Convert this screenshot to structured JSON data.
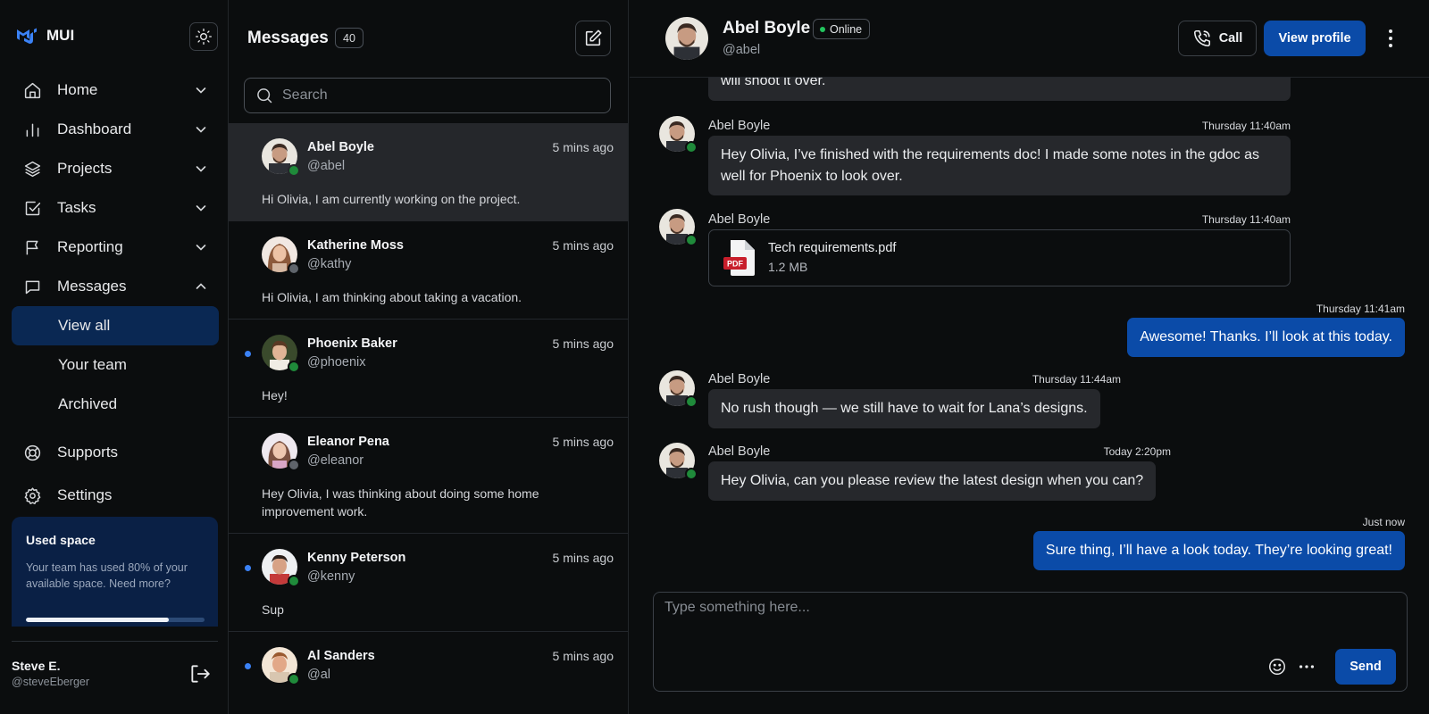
{
  "brand": {
    "name": "MUI",
    "accent": "#3b82f6"
  },
  "sidebar": {
    "items": [
      {
        "label": "Home",
        "icon": "home-icon"
      },
      {
        "label": "Dashboard",
        "icon": "bar-chart-icon"
      },
      {
        "label": "Projects",
        "icon": "layers-icon"
      },
      {
        "label": "Tasks",
        "icon": "check-square-icon"
      },
      {
        "label": "Reporting",
        "icon": "flag-icon"
      },
      {
        "label": "Messages",
        "icon": "message-icon"
      }
    ],
    "subitems": [
      {
        "label": "View all",
        "active": true
      },
      {
        "label": "Your team"
      },
      {
        "label": "Archived"
      }
    ],
    "bottom": [
      {
        "label": "Supports",
        "icon": "life-buoy-icon"
      },
      {
        "label": "Settings",
        "icon": "gear-icon"
      }
    ],
    "space_card": {
      "title": "Used space",
      "text": "Your team has used 80% of your available space. Need more?",
      "used_fraction": 0.8
    },
    "user": {
      "name": "Steve E.",
      "handle": "@steveEberger"
    }
  },
  "list": {
    "title": "Messages",
    "count": "40",
    "search_placeholder": "Search",
    "conversations": [
      {
        "name": "Abel Boyle",
        "handle": "@abel",
        "time": "5 mins ago",
        "text": "Hi Olivia, I am currently working on the project.",
        "online": true,
        "unread": false,
        "selected": true
      },
      {
        "name": "Katherine Moss",
        "handle": "@kathy",
        "time": "5 mins ago",
        "text": "Hi Olivia, I am thinking about taking a vacation.",
        "online": false,
        "unread": false
      },
      {
        "name": "Phoenix Baker",
        "handle": "@phoenix",
        "time": "5 mins ago",
        "text": "Hey!",
        "online": true,
        "unread": true
      },
      {
        "name": "Eleanor Pena",
        "handle": "@eleanor",
        "time": "5 mins ago",
        "text": "Hey Olivia, I was thinking about doing some home improvement work.",
        "online": false,
        "unread": false
      },
      {
        "name": "Kenny Peterson",
        "handle": "@kenny",
        "time": "5 mins ago",
        "text": "Sup",
        "online": true,
        "unread": true
      },
      {
        "name": "Al Sanders",
        "handle": "@al",
        "time": "5 mins ago",
        "text": "",
        "online": true,
        "unread": true
      }
    ]
  },
  "chat": {
    "contact": {
      "name": "Abel Boyle",
      "status": "Online",
      "handle": "@abel"
    },
    "call_label": "Call",
    "profile_label": "View profile",
    "messages": {
      "m0_text": "will shoot it over.",
      "m1_sender": "Abel Boyle",
      "m1_time": "Thursday 11:40am",
      "m1_text": "Hey Olivia, I’ve finished with the requirements doc! I made some notes in the gdoc as well for Phoenix to look over.",
      "m2_sender": "Abel Boyle",
      "m2_time": "Thursday 11:40am",
      "m2_file_name": "Tech requirements.pdf",
      "m2_file_size": "1.2 MB",
      "m2_file_type": "PDF",
      "m3_time": "Thursday 11:41am",
      "m3_text": "Awesome! Thanks. I’ll look at this today.",
      "m4_sender": "Abel Boyle",
      "m4_time": "Thursday 11:44am",
      "m4_text": "No rush though — we still have to wait for Lana’s designs.",
      "m5_sender": "Abel Boyle",
      "m5_time": "Today 2:20pm",
      "m5_text": "Hey Olivia, can you please review the latest design when you can?",
      "m6_time": "Just now",
      "m6_text": "Sure thing, I’ll have a look today. They’re looking great!"
    },
    "composer_placeholder": "Type something here...",
    "send_label": "Send"
  },
  "colors": {
    "primary": "#0b4ba8",
    "online": "#1f8a3a",
    "active_nav": "#0a2853"
  }
}
